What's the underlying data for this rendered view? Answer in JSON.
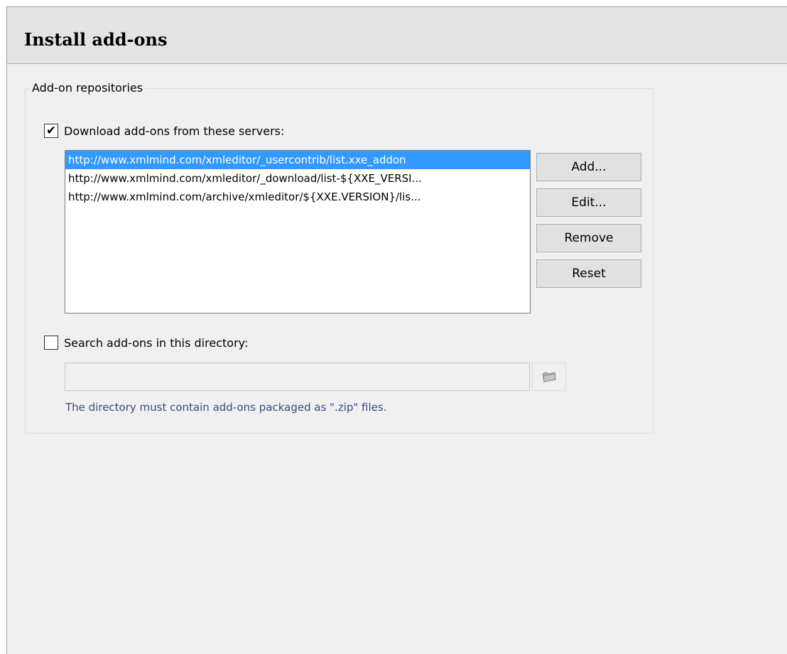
{
  "header": {
    "title": "Install add-ons"
  },
  "repositories": {
    "legend": "Add-on repositories",
    "download": {
      "checked": true,
      "label": "Download add-ons from these servers:",
      "servers": [
        "http://www.xmlmind.com/xmleditor/_usercontrib/list.xxe_addon",
        "http://www.xmlmind.com/xmleditor/_download/list-${XXE_VERSI...",
        "http://www.xmlmind.com/archive/xmleditor/${XXE.VERSION}/lis..."
      ],
      "selected_index": 0,
      "buttons": {
        "add": "Add...",
        "edit": "Edit...",
        "remove": "Remove",
        "reset": "Reset"
      }
    },
    "directory": {
      "checked": false,
      "label": "Search add-ons in this directory:",
      "value": "",
      "hint": "The directory must contain add-ons packaged as \".zip\" files."
    }
  },
  "icons": {
    "checkmark": "check-icon",
    "folder": "folder-icon"
  },
  "colors": {
    "selection": "#3399ff",
    "hint_text": "#3c4a7d",
    "header_bg": "#e4e4e4"
  }
}
